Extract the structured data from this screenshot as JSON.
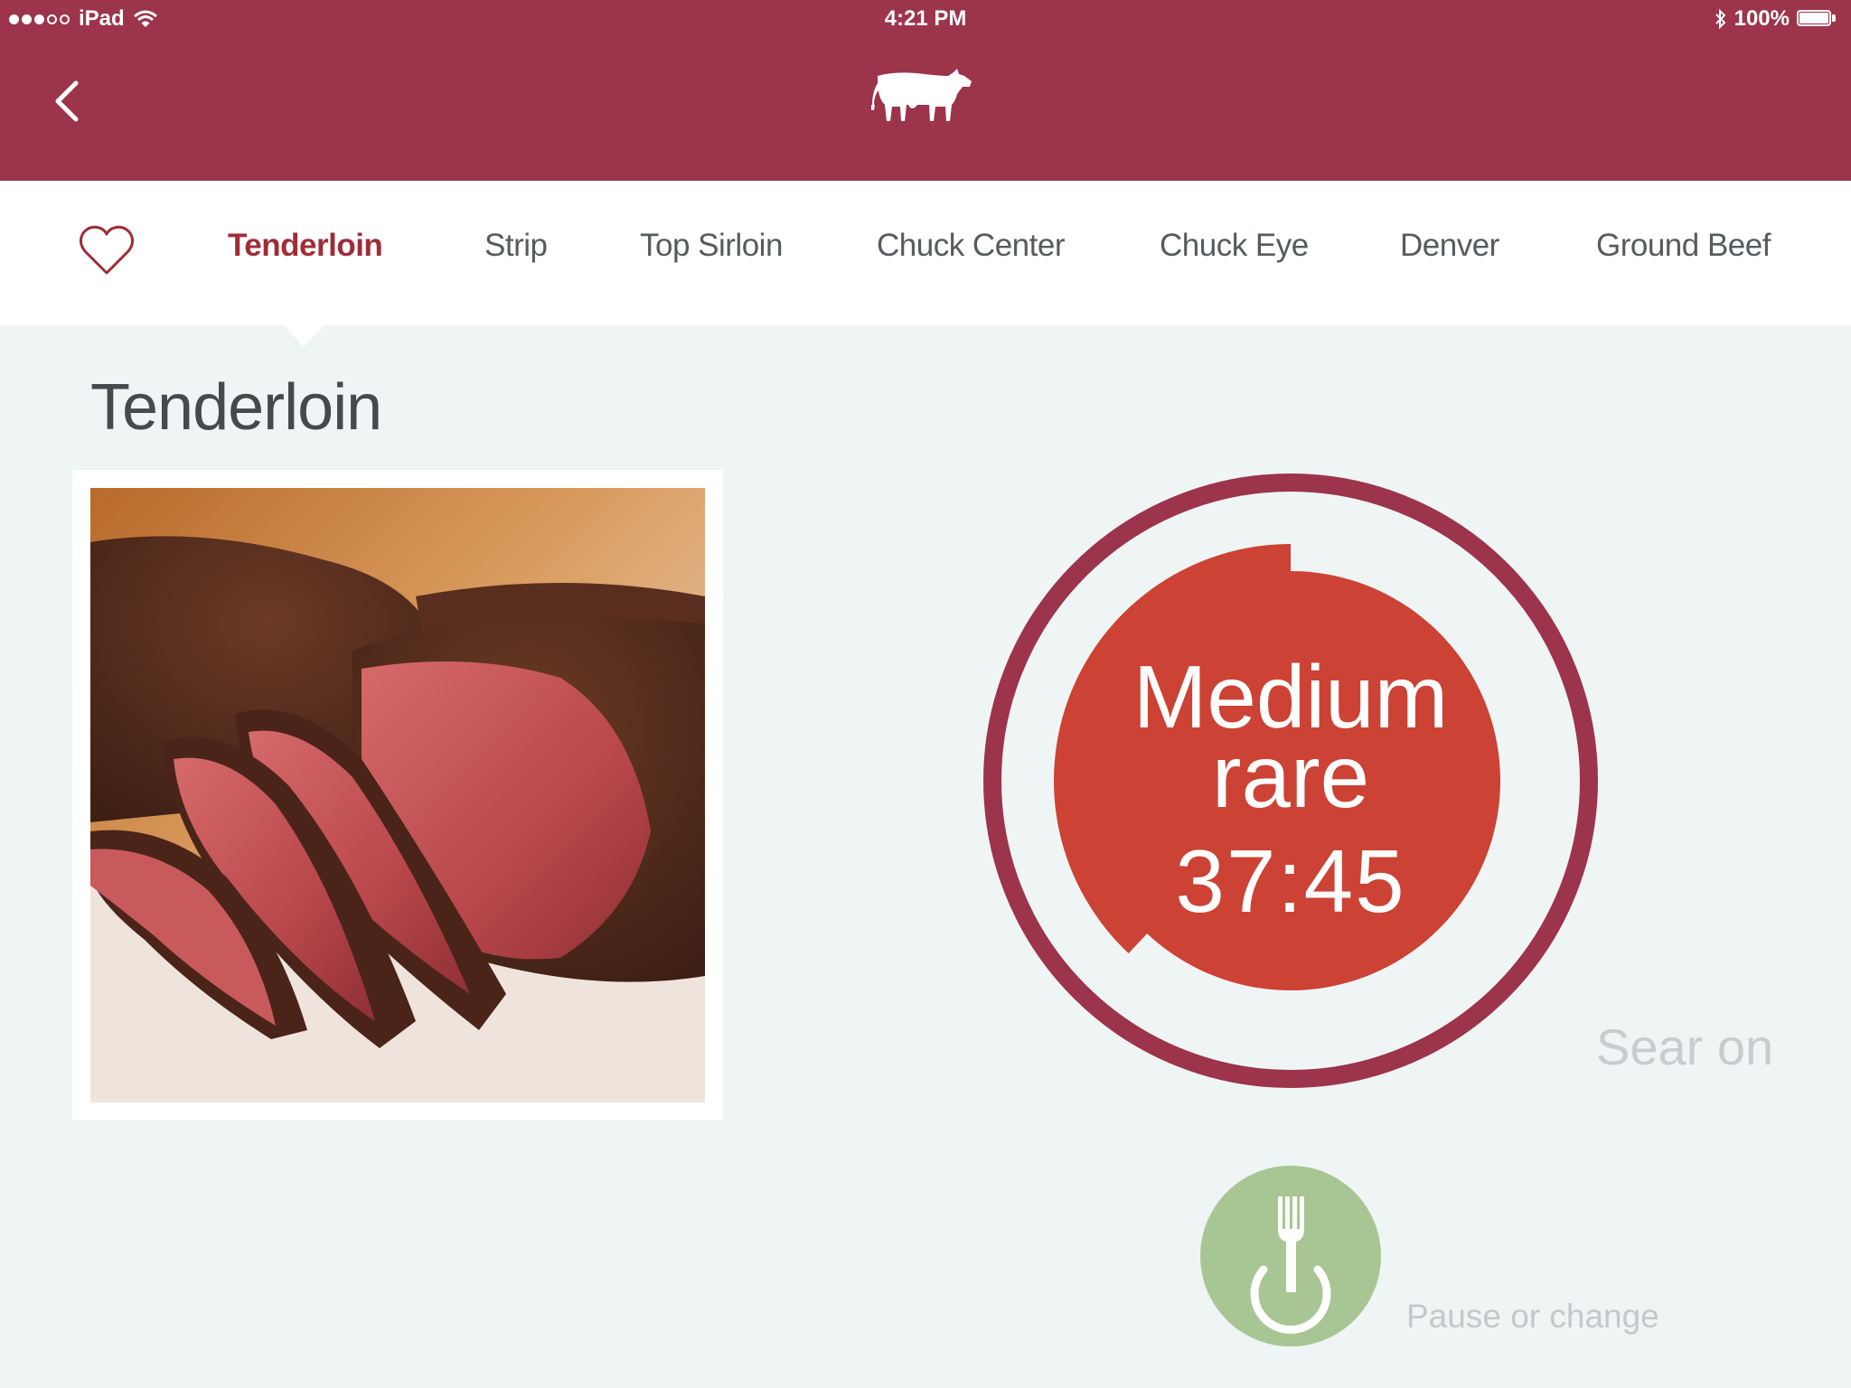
{
  "status_bar": {
    "carrier": "iPad",
    "time": "4:21 PM",
    "battery": "100%",
    "icons": [
      "signal-dots",
      "wifi-icon",
      "bluetooth-icon",
      "battery-icon"
    ]
  },
  "header": {
    "back_icon": "chevron-left-icon",
    "logo_icon": "cow-icon"
  },
  "tabs": {
    "favorite_icon": "heart-icon",
    "items": [
      {
        "label": "Tenderloin",
        "active": true
      },
      {
        "label": "Strip",
        "active": false
      },
      {
        "label": "Top Sirloin",
        "active": false
      },
      {
        "label": "Chuck Center",
        "active": false
      },
      {
        "label": "Chuck Eye",
        "active": false
      },
      {
        "label": "Denver",
        "active": false
      },
      {
        "label": "Ground Beef",
        "active": false
      }
    ]
  },
  "main": {
    "title": "Tenderloin",
    "timer": {
      "doneness_line1": "Medium",
      "doneness_line2": "rare",
      "countdown": "37:45",
      "progress_fraction": 0.62
    },
    "sear_label": "Sear on",
    "pause_label": "Pause or change",
    "pause_icon": "fork-power-icon"
  },
  "colors": {
    "brand": "#9c344b",
    "active_tab": "#9e2d38",
    "timer_fill": "#cc4234",
    "timer_ring": "#9c344b",
    "pause_button": "#a8c693",
    "background": "#eff4f4"
  }
}
